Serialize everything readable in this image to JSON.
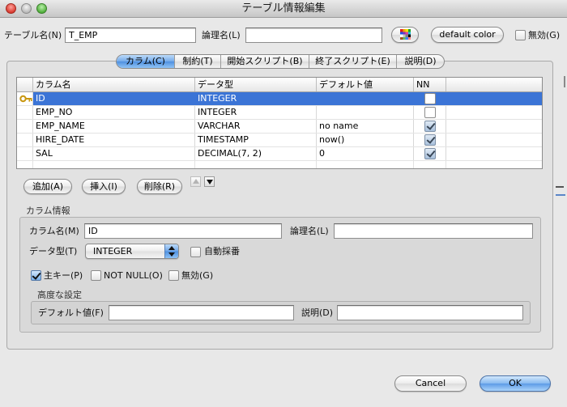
{
  "window": {
    "title": "テーブル情報編集"
  },
  "header": {
    "table_name_label": "テーブル名(N)",
    "table_name_value": "T_EMP",
    "logical_name_label": "論理名(L)",
    "logical_name_value": "",
    "default_color_label": "default color",
    "disabled_label": "無効(G)",
    "disabled_checked": false
  },
  "tabs": [
    {
      "label": "カラム(C)",
      "selected": true
    },
    {
      "label": "制約(T)",
      "selected": false
    },
    {
      "label": "開始スクリプト(B)",
      "selected": false
    },
    {
      "label": "終了スクリプト(E)",
      "selected": false
    },
    {
      "label": "説明(D)",
      "selected": false
    }
  ],
  "columns_table": {
    "headers": [
      "カラム名",
      "データ型",
      "デフォルト値",
      "NN"
    ],
    "rows": [
      {
        "primary_key": true,
        "name": "ID",
        "type": "INTEGER",
        "default": "",
        "not_null": false,
        "selected": true
      },
      {
        "primary_key": false,
        "name": "EMP_NO",
        "type": "INTEGER",
        "default": "",
        "not_null": false,
        "selected": false
      },
      {
        "primary_key": false,
        "name": "EMP_NAME",
        "type": "VARCHAR",
        "default": "no name",
        "not_null": true,
        "selected": false
      },
      {
        "primary_key": false,
        "name": "HIRE_DATE",
        "type": "TIMESTAMP",
        "default": "now()",
        "not_null": true,
        "selected": false
      },
      {
        "primary_key": false,
        "name": "SAL",
        "type": "DECIMAL(7, 2)",
        "default": "0",
        "not_null": true,
        "selected": false
      }
    ]
  },
  "row_buttons": {
    "add": "追加(A)",
    "insert": "挿入(I)",
    "delete": "削除(R)",
    "move_up_enabled": false,
    "move_down_enabled": true
  },
  "column_info": {
    "group_label": "カラム情報",
    "name_label": "カラム名(M)",
    "name_value": "ID",
    "logical_label": "論理名(L)",
    "logical_value": "",
    "type_label": "データ型(T)",
    "type_value": "INTEGER",
    "auto_increment_label": "自動採番",
    "auto_increment_checked": false,
    "primary_key_label": "主キー(P)",
    "primary_key_checked": true,
    "not_null_label": "NOT NULL(O)",
    "not_null_checked": false,
    "disabled_label": "無効(G)",
    "disabled_checked": false,
    "advanced": {
      "label": "高度な設定",
      "default_label": "デフォルト値(F)",
      "default_value": "",
      "description_label": "説明(D)",
      "description_value": ""
    }
  },
  "footer": {
    "cancel": "Cancel",
    "ok": "OK"
  },
  "colors": {
    "accent": "#3b74d6",
    "window_bg": "#e8e8e8",
    "panel_bg": "#e2e2e2",
    "group_bg": "#d9d9d9",
    "close": "#d9392f",
    "zoom": "#4fae3a"
  },
  "icons": {
    "traffic_lights": [
      "close-icon",
      "minimize-icon",
      "zoom-icon"
    ],
    "color_palette": "color-palette-icon",
    "primary_key": "key-icon",
    "move_up": "triangle-up-icon",
    "move_down": "triangle-down-icon",
    "select_arrows": "popup-arrows-icon"
  }
}
